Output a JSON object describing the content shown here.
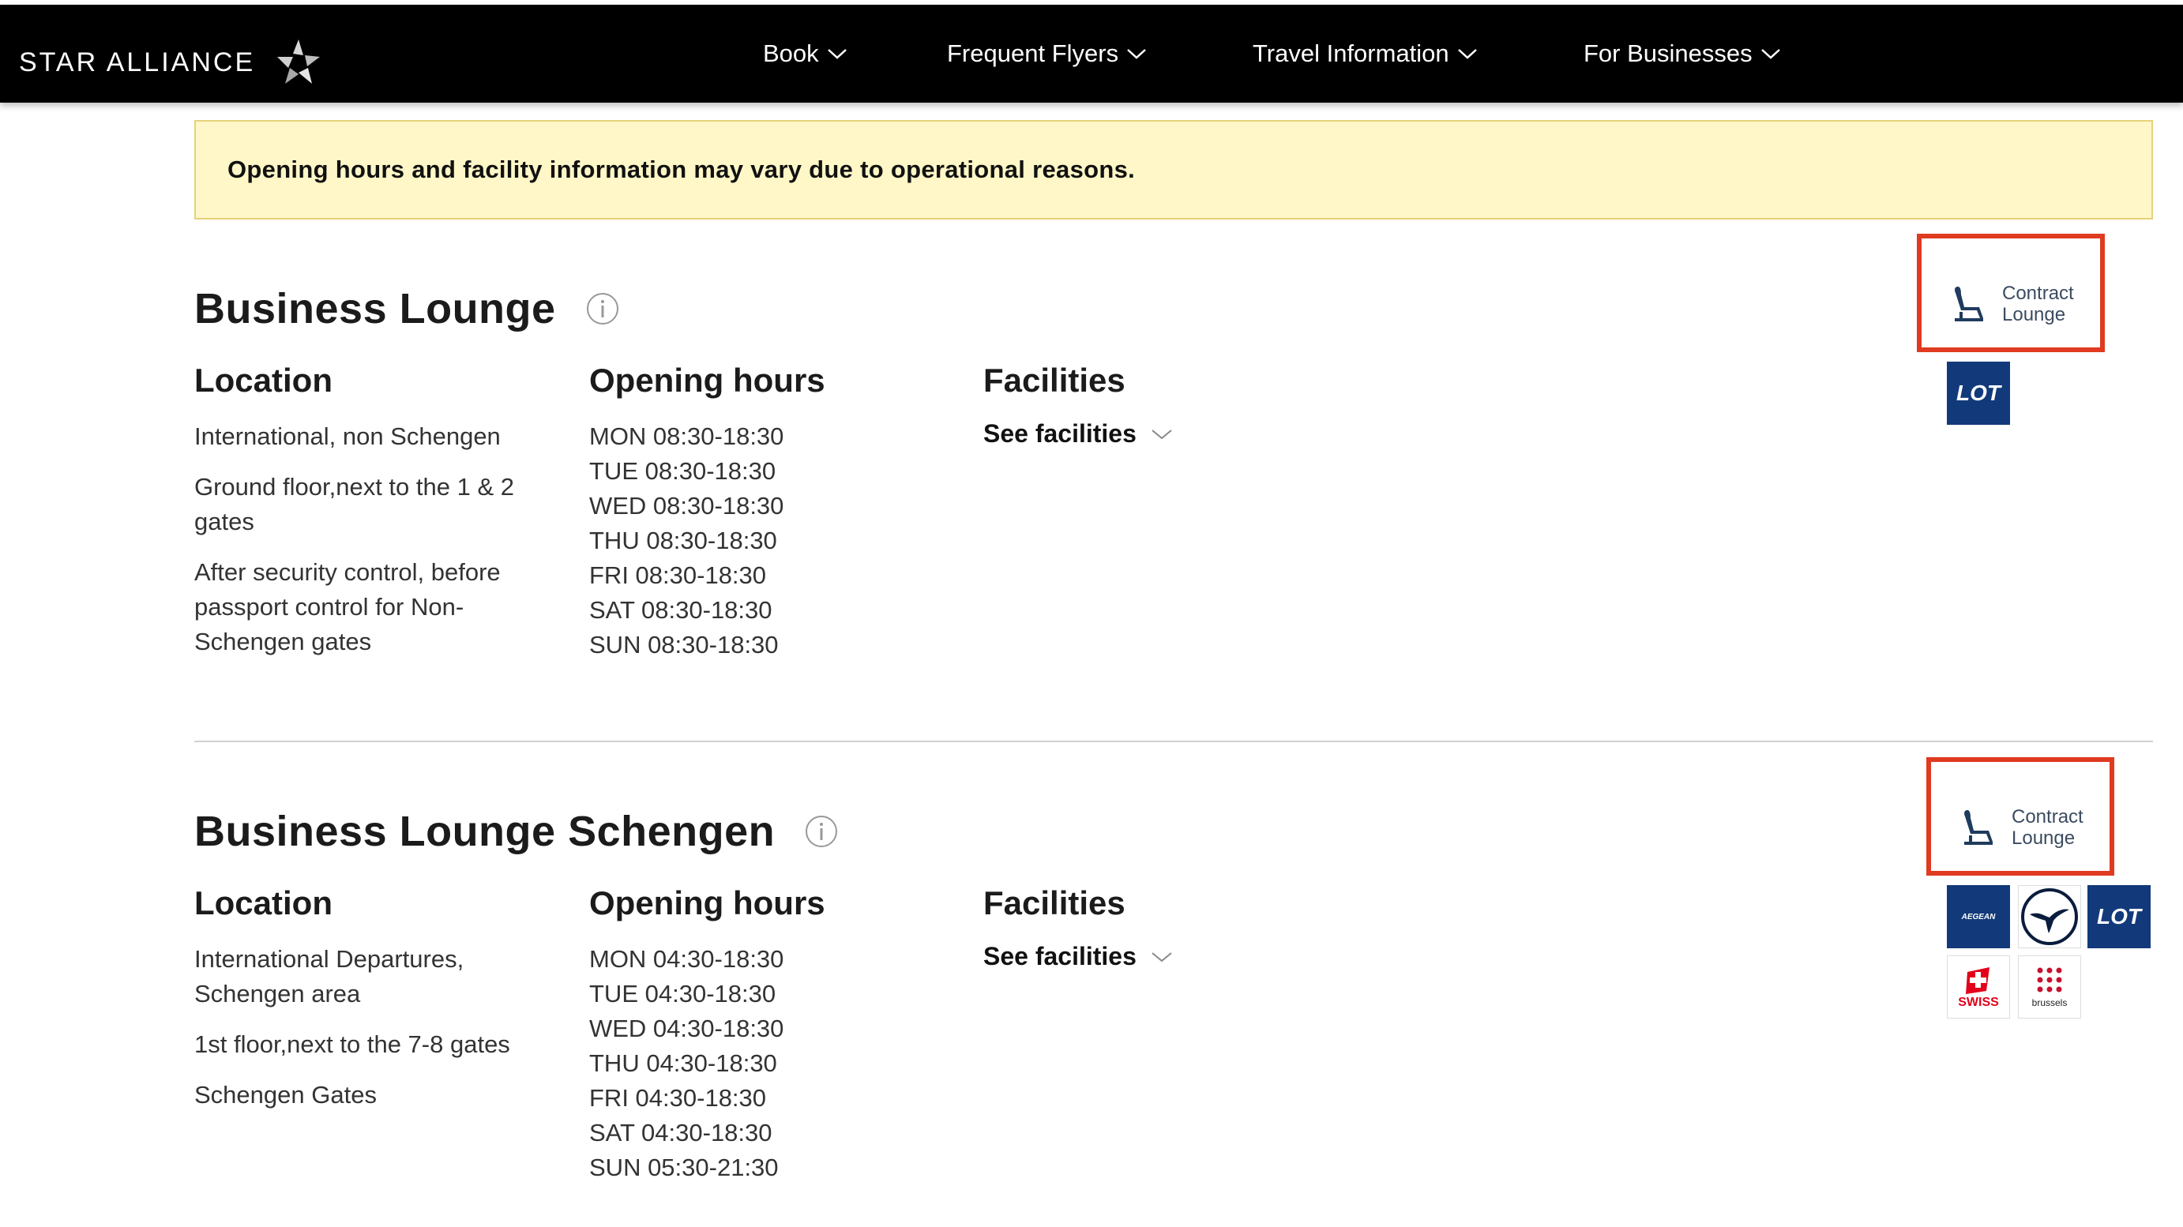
{
  "header": {
    "brand": "STAR ALLIANCE",
    "nav": [
      {
        "label": "Book"
      },
      {
        "label": "Frequent Flyers"
      },
      {
        "label": "Travel Information"
      },
      {
        "label": "For Businesses"
      }
    ]
  },
  "notice": "Opening hours and facility information may vary due to operational reasons.",
  "lounges": [
    {
      "title": "Business Lounge",
      "location_heading": "Location",
      "hours_heading": "Opening hours",
      "facilities_heading": "Facilities",
      "location": [
        "International, non Schengen",
        "Ground floor,next to the 1 & 2 gates",
        "After security control, before passport control for Non-Schengen gates"
      ],
      "hours": [
        "MON 08:30-18:30",
        "TUE 08:30-18:30",
        "WED 08:30-18:30",
        "THU 08:30-18:30",
        "FRI 08:30-18:30",
        "SAT 08:30-18:30",
        "SUN 08:30-18:30"
      ],
      "see_facilities": "See facilities",
      "badge": [
        "Contract",
        "Lounge"
      ],
      "airlines": [
        "LOT"
      ]
    },
    {
      "title": "Business Lounge Schengen",
      "location_heading": "Location",
      "hours_heading": "Opening hours",
      "facilities_heading": "Facilities",
      "location": [
        "International Departures, Schengen area",
        "1st floor,next to the 7-8 gates",
        "Schengen Gates"
      ],
      "hours": [
        "MON 04:30-18:30",
        "TUE 04:30-18:30",
        "WED 04:30-18:30",
        "THU 04:30-18:30",
        "FRI 04:30-18:30",
        "SAT 04:30-18:30",
        "SUN 05:30-21:30"
      ],
      "see_facilities": "See facilities",
      "badge": [
        "Contract",
        "Lounge"
      ],
      "airlines": [
        "AEGEAN",
        "Lufthansa",
        "LOT",
        "SWISS",
        "brussels"
      ]
    }
  ],
  "colors": {
    "header_bg": "#000000",
    "notice_bg": "#fff7c7",
    "highlight_border": "#e03a20",
    "airline_blue": "#123a7a"
  }
}
